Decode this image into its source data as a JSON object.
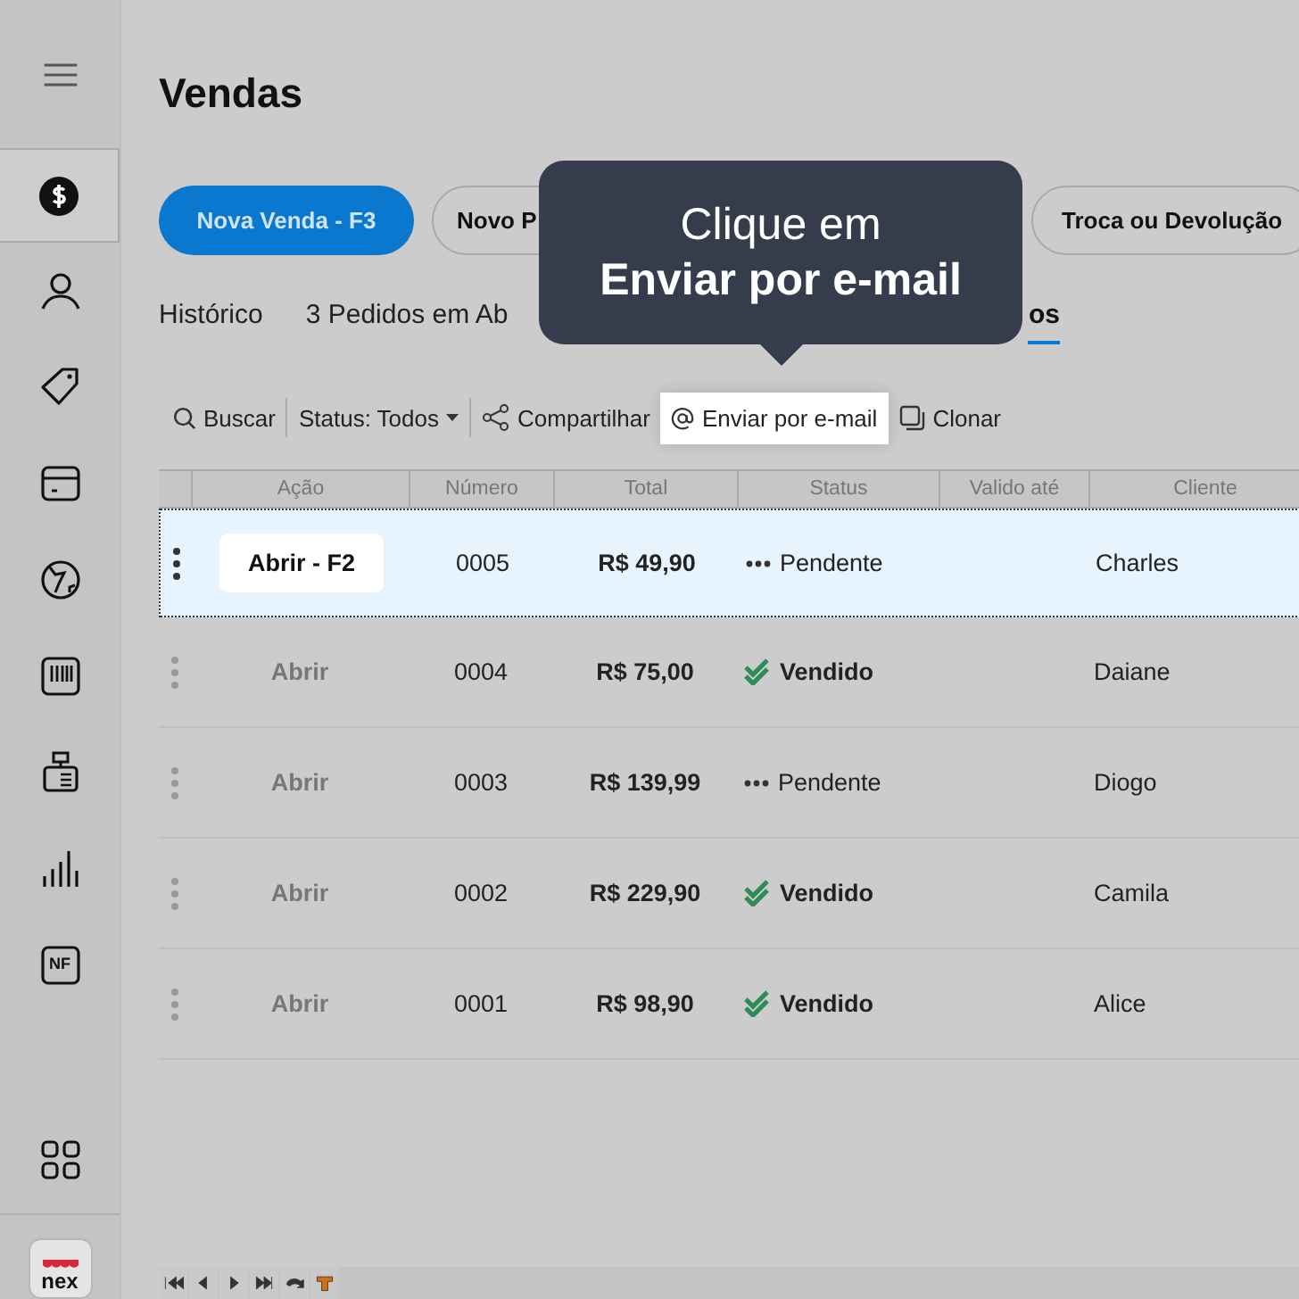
{
  "sidebar": {
    "items": [
      {
        "kind": "dollar",
        "selected": true
      },
      {
        "kind": "person",
        "selected": false
      },
      {
        "kind": "tag",
        "selected": false
      },
      {
        "kind": "box",
        "selected": false
      },
      {
        "kind": "globe",
        "selected": false
      },
      {
        "kind": "barcode",
        "selected": false
      },
      {
        "kind": "register",
        "selected": false
      },
      {
        "kind": "bars",
        "selected": false
      },
      {
        "kind": "nf",
        "label": "NF",
        "selected": false
      }
    ],
    "logo": "nex"
  },
  "title": "Vendas",
  "buttons": [
    {
      "label": "Nova Venda - F3",
      "kind": "primary"
    },
    {
      "label": "Novo P",
      "kind": "outline"
    },
    {
      "label": "Troca ou Devolução",
      "kind": "outline"
    }
  ],
  "tabs": [
    {
      "label": "Histórico",
      "selected": false
    },
    {
      "label": "3 Pedidos em Ab",
      "selected": false
    },
    {
      "label": "os",
      "selected": true
    }
  ],
  "tooltip": {
    "line_1": "Clique em",
    "line_2": "Enviar por e-mail"
  },
  "toolbar": [
    {
      "kind": "search",
      "label": "Buscar",
      "highlighted": false
    },
    {
      "kind": "dropdown",
      "label": "Status: Todos",
      "highlighted": false
    },
    {
      "kind": "share",
      "label": "Compartilhar",
      "highlighted": false
    },
    {
      "kind": "email",
      "label": "Enviar por e-mail",
      "highlighted": true
    },
    {
      "kind": "clone",
      "label": "Clonar",
      "highlighted": false
    }
  ],
  "table": {
    "columns": [
      "Ação",
      "Número",
      "Total",
      "Status",
      "Valido até",
      "Cliente"
    ],
    "rows": [
      {
        "action": "Abrir - F2",
        "number": "0005",
        "total": "R$ 49,90",
        "status": {
          "kind": "pending",
          "label": "Pendente"
        },
        "client": "Charles",
        "selected": true
      },
      {
        "action": "Abrir",
        "number": "0004",
        "total": "R$ 75,00",
        "status": {
          "kind": "sold",
          "label": "Vendido"
        },
        "client": "Daiane",
        "selected": false
      },
      {
        "action": "Abrir",
        "number": "0003",
        "total": "R$ 139,99",
        "status": {
          "kind": "pending",
          "label": "Pendente"
        },
        "client": "Diogo",
        "selected": false
      },
      {
        "action": "Abrir",
        "number": "0002",
        "total": "R$ 229,90",
        "status": {
          "kind": "sold",
          "label": "Vendido"
        },
        "client": "Camila",
        "selected": false
      },
      {
        "action": "Abrir",
        "number": "0001",
        "total": "R$ 98,90",
        "status": {
          "kind": "sold",
          "label": "Vendido"
        },
        "client": "Alice",
        "selected": false
      }
    ]
  },
  "pager": [
    {
      "kind": "first"
    },
    {
      "kind": "prev"
    },
    {
      "kind": "next"
    },
    {
      "kind": "last"
    },
    {
      "kind": "refresh"
    },
    {
      "kind": "filter"
    }
  ]
}
